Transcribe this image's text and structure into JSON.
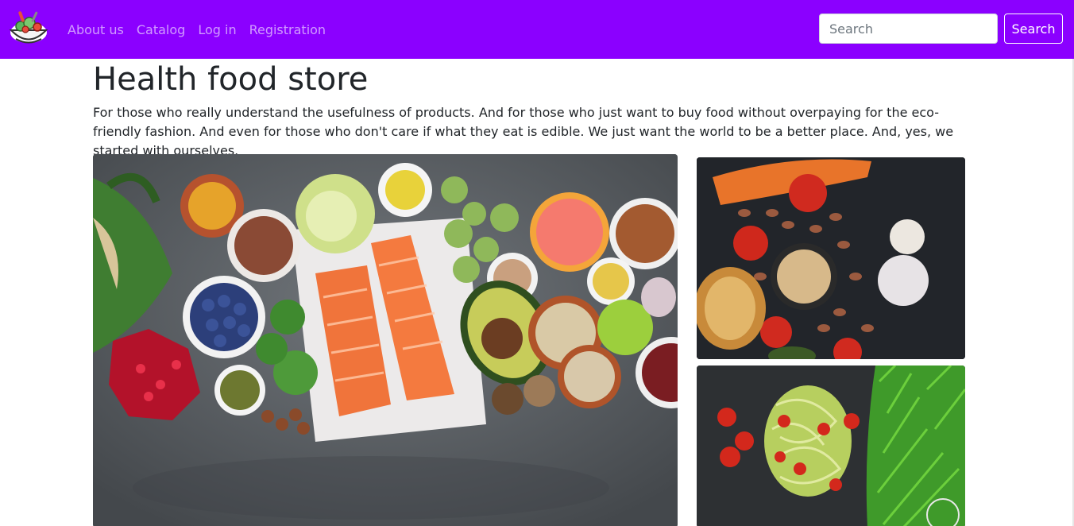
{
  "navbar": {
    "background": "#8b00ff",
    "logo_icon": "salad-bowl-icon",
    "links": [
      "About us",
      "Catalog",
      "Log in",
      "Registration"
    ],
    "search": {
      "placeholder": "Search",
      "value": ""
    },
    "search_button": "Search"
  },
  "main": {
    "title": "Health food store",
    "lead": "For those who really understand the usefulness of products. And for those who just want to buy food without overpaying for the eco-friendly fashion. And even for those who don't care if what they eat is edible. We just want the world to be a better place. And, yes, we started with ourselves.",
    "images": [
      {
        "icon": "healthy-food-spread-photo"
      },
      {
        "icon": "vegetables-nuts-photo"
      },
      {
        "icon": "zucchini-noodles-photo"
      }
    ]
  }
}
